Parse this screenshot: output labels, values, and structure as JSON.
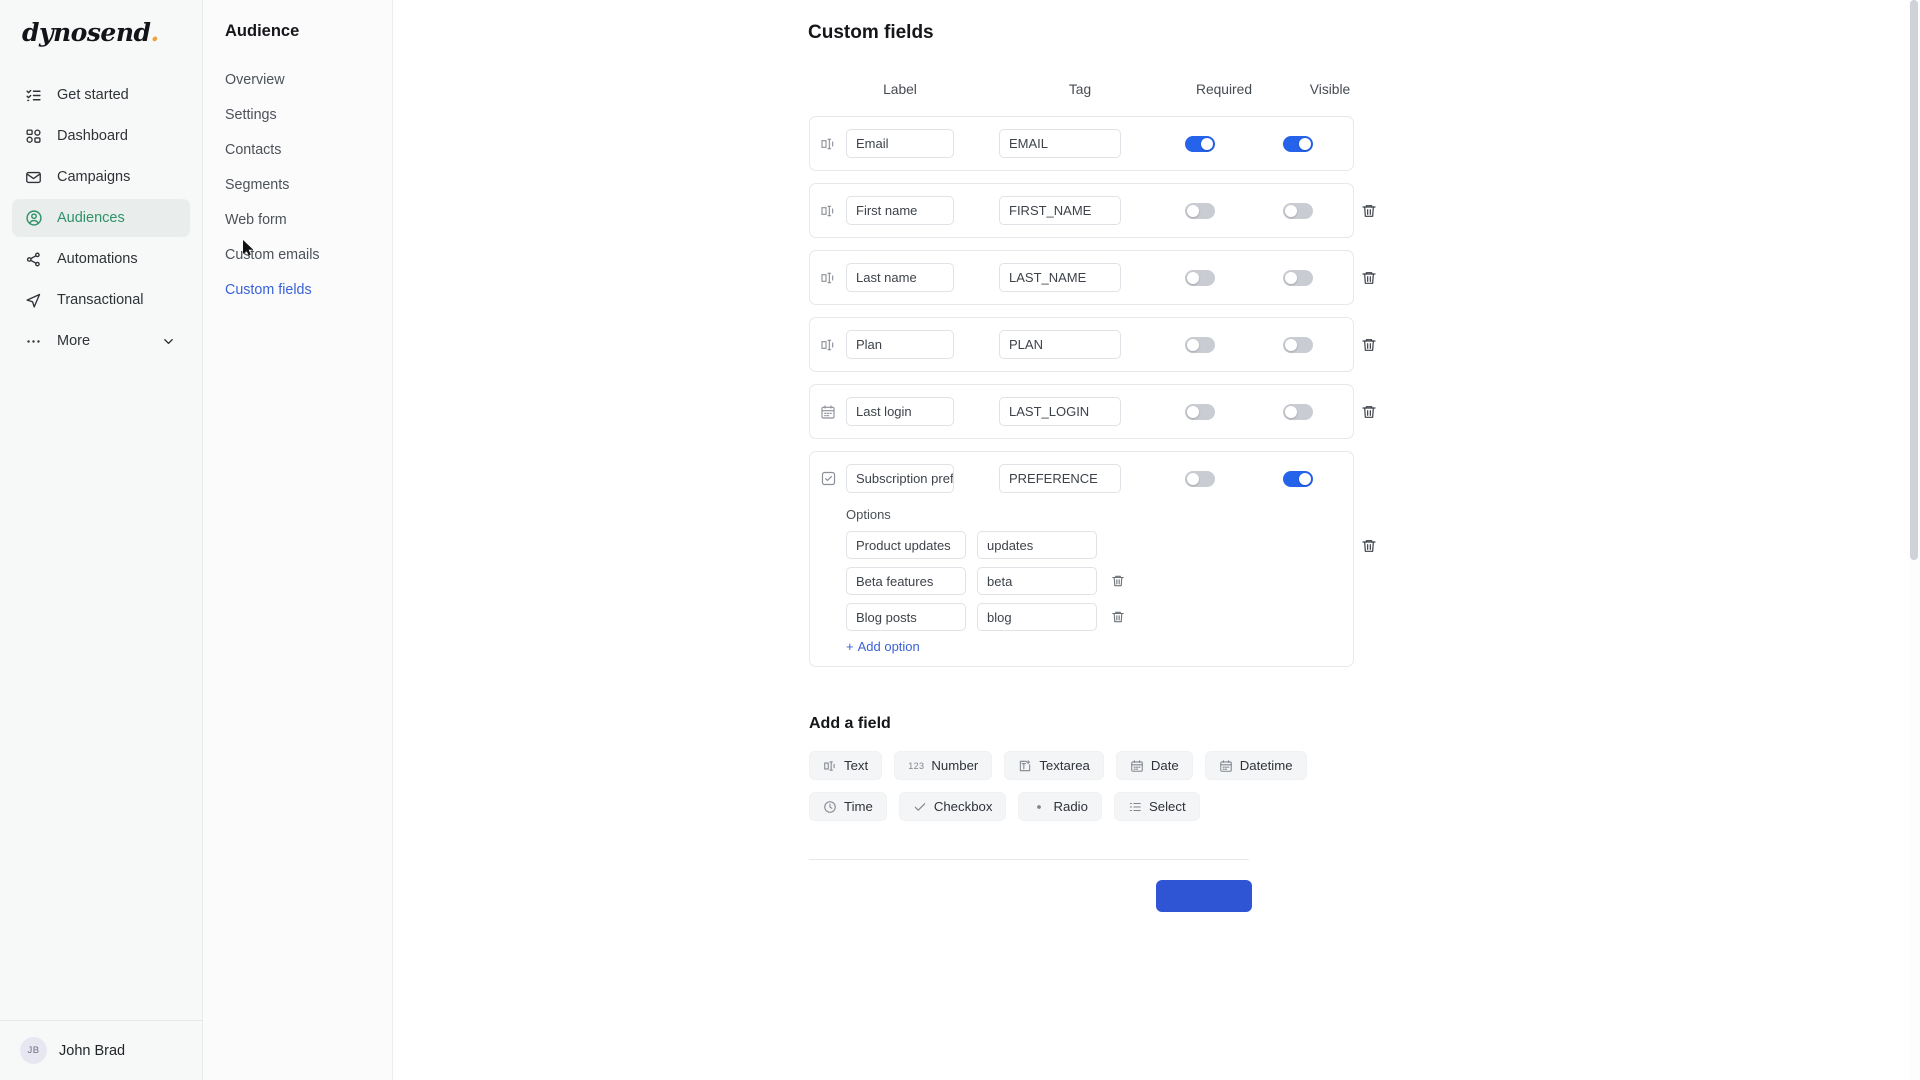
{
  "brand": {
    "name": "dynosend",
    "dot": "."
  },
  "sidebar": {
    "items": [
      {
        "label": "Get started",
        "icon": "list-check-icon"
      },
      {
        "label": "Dashboard",
        "icon": "dashboard-grid-icon"
      },
      {
        "label": "Campaigns",
        "icon": "envelope-icon"
      },
      {
        "label": "Audiences",
        "icon": "user-circle-icon"
      },
      {
        "label": "Automations",
        "icon": "automation-nodes-icon"
      },
      {
        "label": "Transactional",
        "icon": "paper-plane-icon"
      },
      {
        "label": "More",
        "icon": "ellipsis-icon"
      }
    ],
    "active_index": 3,
    "user": {
      "initials": "JB",
      "name": "John Brad"
    }
  },
  "subnav": {
    "title": "Audience",
    "items": [
      {
        "label": "Overview"
      },
      {
        "label": "Settings"
      },
      {
        "label": "Contacts"
      },
      {
        "label": "Segments"
      },
      {
        "label": "Web form"
      },
      {
        "label": "Custom emails"
      },
      {
        "label": "Custom fields"
      }
    ],
    "active_index": 6
  },
  "main": {
    "title": "Custom fields",
    "columns": {
      "label": "Label",
      "tag": "Tag",
      "required": "Required",
      "visible": "Visible"
    },
    "fields": [
      {
        "icon": "text-field-icon",
        "label": "Email",
        "tag": "EMAIL",
        "required": true,
        "visible": true,
        "deletable": false
      },
      {
        "icon": "text-field-icon",
        "label": "First name",
        "tag": "FIRST_NAME",
        "required": false,
        "visible": false,
        "deletable": true
      },
      {
        "icon": "text-field-icon",
        "label": "Last name",
        "tag": "LAST_NAME",
        "required": false,
        "visible": false,
        "deletable": true
      },
      {
        "icon": "text-field-icon",
        "label": "Plan",
        "tag": "PLAN",
        "required": false,
        "visible": false,
        "deletable": true
      },
      {
        "icon": "calendar-icon",
        "label": "Last login",
        "tag": "LAST_LOGIN",
        "required": false,
        "visible": false,
        "deletable": true
      },
      {
        "icon": "checkbox-icon",
        "label": "Subscription preferen",
        "tag": "PREFERENCE",
        "required": false,
        "visible": true,
        "deletable": true
      }
    ],
    "options_section": {
      "title": "Options",
      "options": [
        {
          "label": "Product updates",
          "tag": "updates",
          "deletable": false
        },
        {
          "label": "Beta features",
          "tag": "beta",
          "deletable": true
        },
        {
          "label": "Blog posts",
          "tag": "blog",
          "deletable": true
        }
      ],
      "add_label": "Add option",
      "add_plus": "+"
    },
    "add_a_field": {
      "title": "Add a field",
      "row1": [
        {
          "label": "Text",
          "icon": "text-field-icon"
        },
        {
          "label": "Number",
          "icon": "number-123-icon"
        },
        {
          "label": "Textarea",
          "icon": "textarea-icon"
        },
        {
          "label": "Date",
          "icon": "calendar-icon"
        },
        {
          "label": "Datetime",
          "icon": "calendar-clock-icon"
        }
      ],
      "row2": [
        {
          "label": "Time",
          "icon": "clock-icon"
        },
        {
          "label": "Checkbox",
          "icon": "check-icon"
        },
        {
          "label": "Radio",
          "icon": "radio-dot-icon"
        },
        {
          "label": "Select",
          "icon": "list-select-icon"
        }
      ]
    }
  },
  "colors": {
    "accent_blue": "#2563eb",
    "link_blue": "#3a62d8",
    "active_green": "#2f9268",
    "brand_dot": "#f0a23c",
    "save_button": "#2f55d4"
  }
}
